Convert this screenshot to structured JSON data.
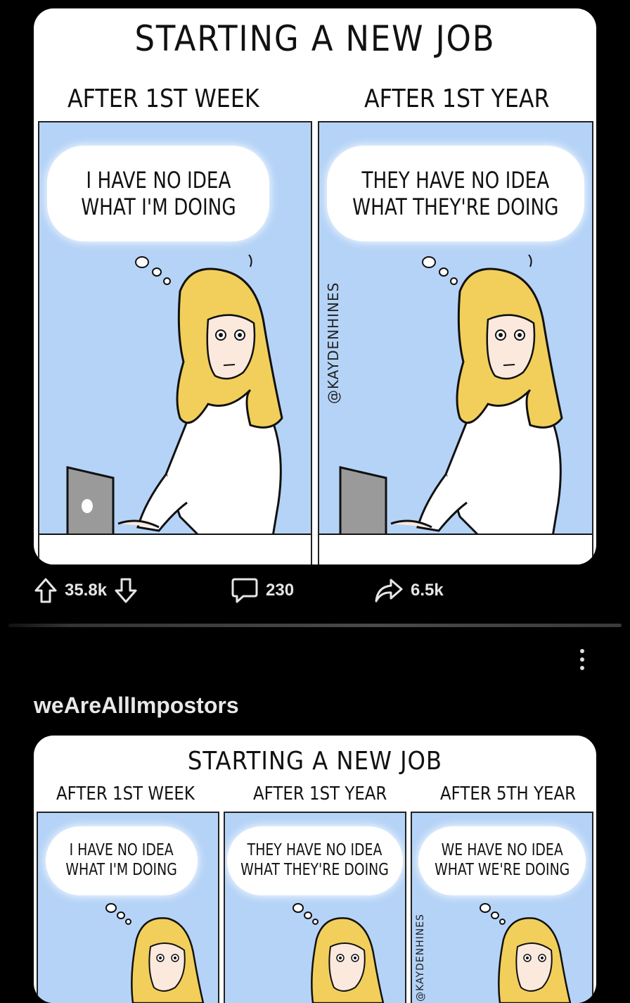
{
  "post1": {
    "comic": {
      "title": "STARTING A NEW JOB",
      "columns": [
        "AFTER 1ST WEEK",
        "AFTER 1ST YEAR"
      ],
      "bubbles": [
        [
          "I HAVE NO IDEA",
          "WHAT I'M DOING"
        ],
        [
          "THEY HAVE NO IDEA",
          "WHAT THEY'RE DOING"
        ]
      ],
      "artist_handle": "@KAYDENHINES"
    },
    "actions": {
      "upvotes": "35.8k",
      "comments": "230",
      "shares": "6.5k"
    }
  },
  "post2": {
    "subreddit": "weAreAllImpostors",
    "comic": {
      "title": "STARTING A NEW JOB",
      "columns": [
        "AFTER 1ST WEEK",
        "AFTER 1ST YEAR",
        "AFTER 5TH YEAR"
      ],
      "bubbles": [
        [
          "I HAVE NO IDEA",
          "WHAT I'M DOING"
        ],
        [
          "THEY HAVE NO IDEA",
          "WHAT THEY'RE DOING"
        ],
        [
          "WE HAVE NO IDEA",
          "WHAT WE'RE DOING"
        ]
      ],
      "artist_handle": "@KAYDENHINES"
    }
  },
  "icons": [
    "upvote-icon",
    "downvote-icon",
    "comment-icon",
    "share-icon",
    "more-options-icon",
    "apple-logo-icon"
  ],
  "colors": {
    "background": "#000000",
    "panel_blue": "#b5d3f7",
    "hair": "#f2cf5b",
    "laptop": "#9a9a9a"
  }
}
